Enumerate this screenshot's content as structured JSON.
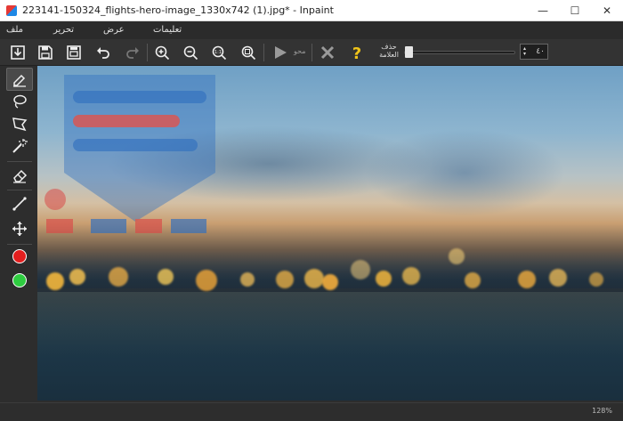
{
  "window": {
    "title": "223141-150324_flights-hero-image_1330x742 (1).jpg* - Inpaint",
    "minimize_glyph": "—",
    "maximize_glyph": "☐",
    "close_glyph": "✕"
  },
  "menu": {
    "file": "ملف",
    "edit": "تحرير",
    "view": "عرض",
    "help": "تعليمات"
  },
  "toolbar": {
    "erase_label": "محو",
    "watermark_label_top": "حذف",
    "watermark_label_bottom": "العلامة",
    "tolerance_value": "٤٠",
    "tolerance_level": 0.05
  },
  "tools": [
    "marker-tool",
    "lasso-tool",
    "polygonal-lasso-tool",
    "magic-wand-tool",
    "eraser-tool",
    "guide-line-tool",
    "move-tool"
  ],
  "colors": {
    "accent": "#f0c419",
    "primary_color": "#e31e1e",
    "secondary_color": "#2ecc40",
    "watermark_red": "#d94a48",
    "watermark_blue": "#2f6fbf"
  },
  "status": {
    "zoom": "128%"
  }
}
